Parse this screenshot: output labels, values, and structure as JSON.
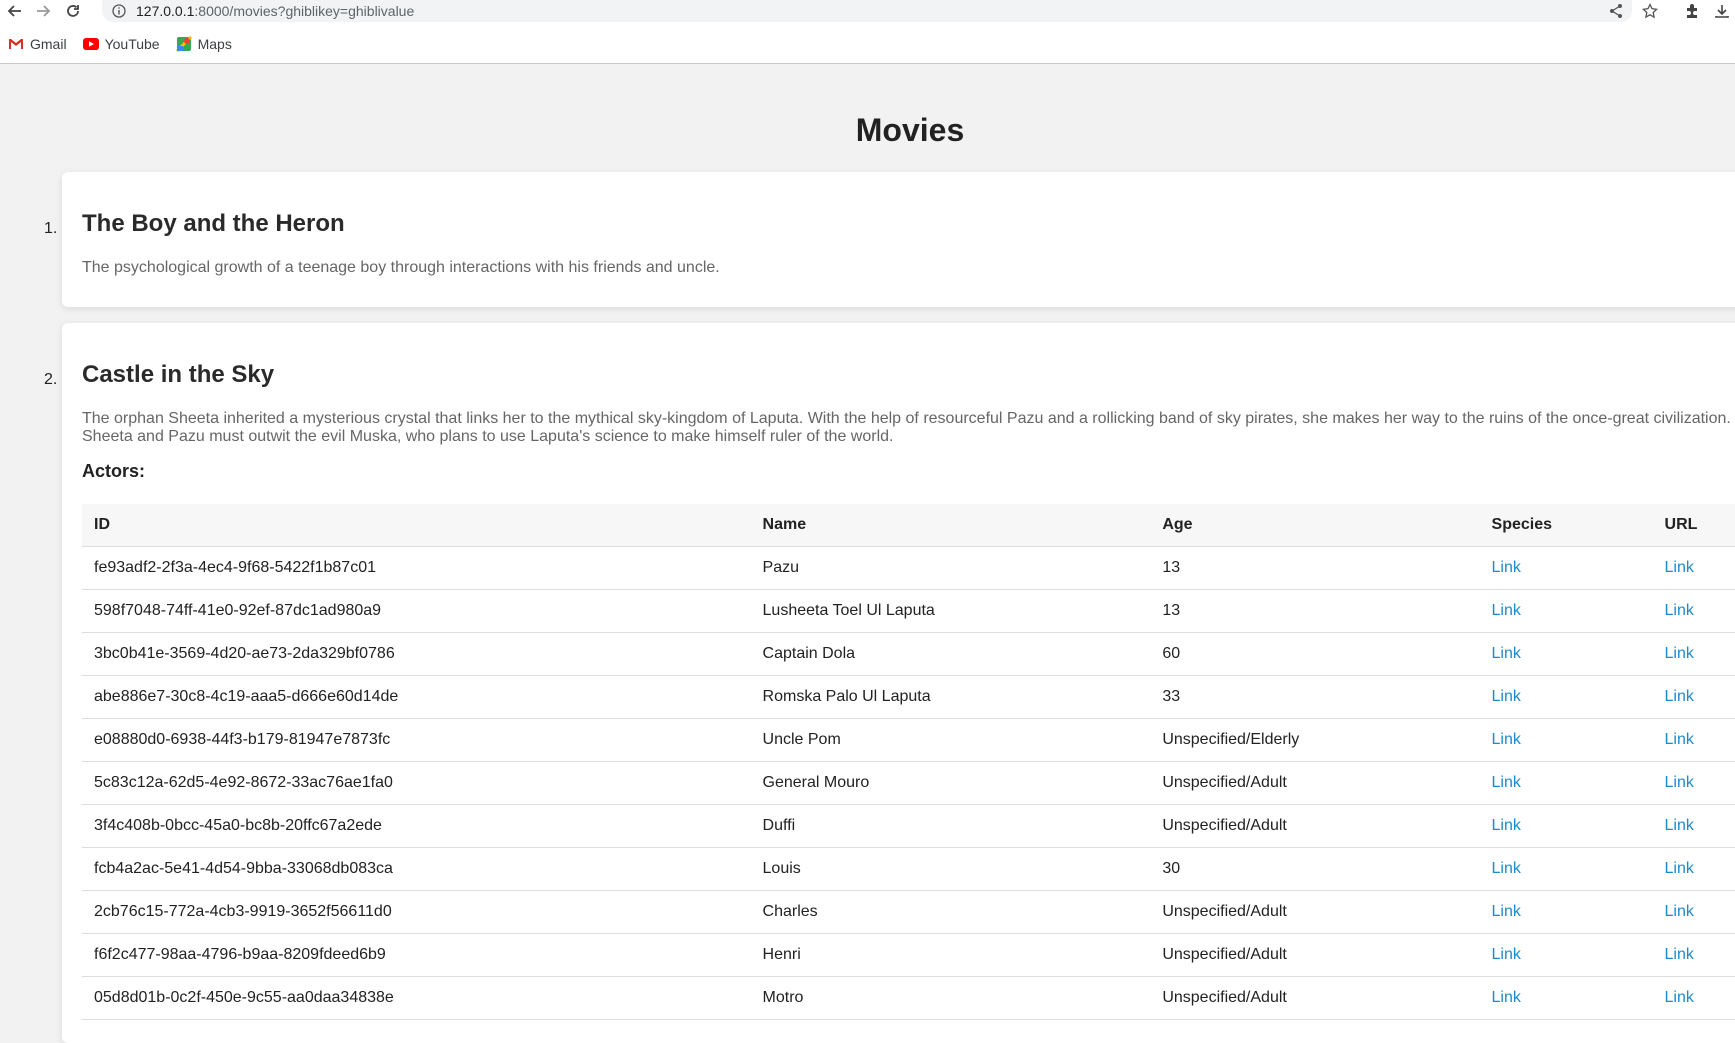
{
  "browser": {
    "url_host": "127.0.0.1",
    "url_path": ":8000/movies?ghiblikey=ghiblivalue",
    "bookmarks": [
      {
        "label": "Gmail",
        "icon": "gmail-icon"
      },
      {
        "label": "YouTube",
        "icon": "youtube-icon"
      },
      {
        "label": "Maps",
        "icon": "maps-icon"
      }
    ]
  },
  "page": {
    "title": "Movies"
  },
  "movies": [
    {
      "number": "1.",
      "title": "The Boy and the Heron",
      "description": "The psychological growth of a teenage boy through interactions with his friends and uncle."
    },
    {
      "number": "2.",
      "title": "Castle in the Sky",
      "description": "The orphan Sheeta inherited a mysterious crystal that links her to the mythical sky-kingdom of Laputa. With the help of resourceful Pazu and a rollicking band of sky pirates, she makes her way to the ruins of the once-great civilization. Sheeta and Pazu must outwit the evil Muska, who plans to use Laputa's science to make himself ruler of the world.",
      "actors_heading": "Actors:",
      "columns": [
        "ID",
        "Name",
        "Age",
        "Species",
        "URL"
      ],
      "actors": [
        {
          "id": "fe93adf2-2f3a-4ec4-9f68-5422f1b87c01",
          "name": "Pazu",
          "age": "13",
          "species": "Link",
          "url": "Link"
        },
        {
          "id": "598f7048-74ff-41e0-92ef-87dc1ad980a9",
          "name": "Lusheeta Toel Ul Laputa",
          "age": "13",
          "species": "Link",
          "url": "Link"
        },
        {
          "id": "3bc0b41e-3569-4d20-ae73-2da329bf0786",
          "name": "Captain Dola",
          "age": "60",
          "species": "Link",
          "url": "Link"
        },
        {
          "id": "abe886e7-30c8-4c19-aaa5-d666e60d14de",
          "name": "Romska Palo Ul Laputa",
          "age": "33",
          "species": "Link",
          "url": "Link"
        },
        {
          "id": "e08880d0-6938-44f3-b179-81947e7873fc",
          "name": "Uncle Pom",
          "age": "Unspecified/Elderly",
          "species": "Link",
          "url": "Link"
        },
        {
          "id": "5c83c12a-62d5-4e92-8672-33ac76ae1fa0",
          "name": "General Mouro",
          "age": "Unspecified/Adult",
          "species": "Link",
          "url": "Link"
        },
        {
          "id": "3f4c408b-0bcc-45a0-bc8b-20ffc67a2ede",
          "name": "Duffi",
          "age": "Unspecified/Adult",
          "species": "Link",
          "url": "Link"
        },
        {
          "id": "fcb4a2ac-5e41-4d54-9bba-33068db083ca",
          "name": "Louis",
          "age": "30",
          "species": "Link",
          "url": "Link"
        },
        {
          "id": "2cb76c15-772a-4cb3-9919-3652f56611d0",
          "name": "Charles",
          "age": "Unspecified/Adult",
          "species": "Link",
          "url": "Link"
        },
        {
          "id": "f6f2c477-98aa-4796-b9aa-8209fdeed6b9",
          "name": "Henri",
          "age": "Unspecified/Adult",
          "species": "Link",
          "url": "Link"
        },
        {
          "id": "05d8d01b-0c2f-450e-9c55-aa0daa34838e",
          "name": "Motro",
          "age": "Unspecified/Adult",
          "species": "Link",
          "url": "Link"
        }
      ]
    }
  ],
  "colors": {
    "link": "#1a8bd0",
    "page_background": "#f2f2f2",
    "card_background": "#ffffff"
  }
}
